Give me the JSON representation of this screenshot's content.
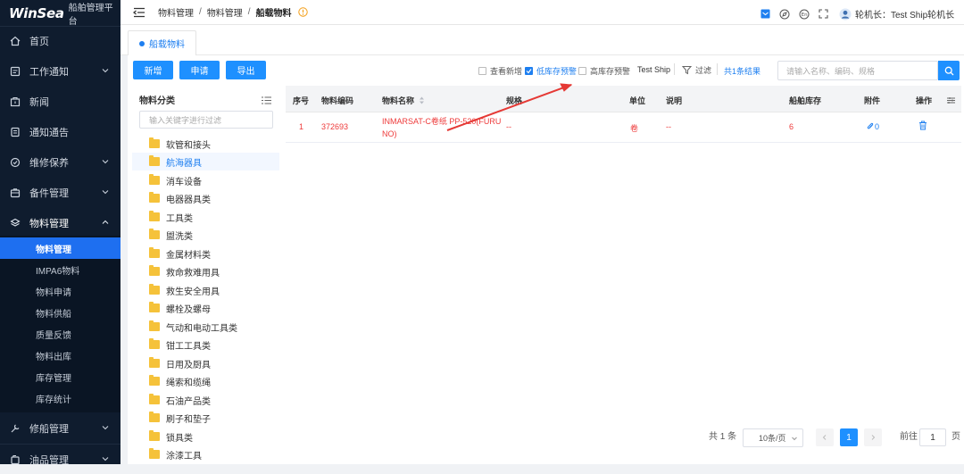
{
  "brand": {
    "logo": "WinSea",
    "subtitle": "船舶管理平台"
  },
  "sidebar": {
    "items": [
      {
        "label": "首页",
        "icon": "home-icon"
      },
      {
        "label": "工作通知",
        "icon": "notice-icon"
      },
      {
        "label": "新闻",
        "icon": "news-icon"
      },
      {
        "label": "通知通告",
        "icon": "announcement-icon"
      },
      {
        "label": "维修保养",
        "icon": "maintenance-icon"
      },
      {
        "label": "备件管理",
        "icon": "spare-parts-icon"
      },
      {
        "label": "物料管理",
        "icon": "materials-icon"
      },
      {
        "label": "修船管理",
        "icon": "repair-icon"
      },
      {
        "label": "油品管理",
        "icon": "oil-icon"
      }
    ],
    "subitems": [
      "物料管理",
      "IMPA6物料",
      "物料申请",
      "物料供船",
      "质量反馈",
      "物料出库",
      "库存管理",
      "库存统计"
    ]
  },
  "breadcrumb": {
    "l1": "物料管理",
    "l2": "物料管理",
    "l3": "船载物料"
  },
  "header": {
    "user": "轮机长：Test Ship轮机长"
  },
  "tab": {
    "label": "船载物料"
  },
  "toolbar": {
    "btn_new": "新增",
    "btn_apply": "申请",
    "btn_export": "导出",
    "chk_view_new": "查看新增",
    "chk_low_stock": "低库存预警",
    "chk_high_stock": "高库存预警",
    "ship": "Test Ship",
    "filter": "过滤",
    "result": "共1条结果",
    "search_placeholder": "请输入名称、编码、规格"
  },
  "tree": {
    "title": "物料分类",
    "placeholder": "输入关键字进行过滤",
    "nodes": [
      "软管和接头",
      "航海器具",
      "消车设备",
      "电器器具类",
      "工具类",
      "盥洗类",
      "金属材料类",
      "救命救难用具",
      "救生安全用具",
      "螺栓及螺母",
      "气动和电动工具类",
      "钳工工具类",
      "日用及厨具",
      "绳索和缆绳",
      "石油产品类",
      "刷子和垫子",
      "锁具类",
      "涂漆工具"
    ]
  },
  "table": {
    "headers": {
      "no": "序号",
      "code": "物料编码",
      "name": "物料名称",
      "spec": "规格",
      "unit": "单位",
      "desc": "说明",
      "stock": "船舶库存",
      "attach": "附件",
      "op": "操作"
    },
    "rows": [
      {
        "no": "1",
        "code": "372693",
        "name_line1": "INMARSAT-C卷纸 PP-520(FURU",
        "name_line2": "NO)",
        "spec": "--",
        "unit": "卷",
        "desc": "--",
        "stock": "6",
        "attach": "0"
      }
    ]
  },
  "pager": {
    "total": "共 1 条",
    "page_size": "10条/页",
    "current": "1",
    "goto_label": "前往",
    "goto_value": "1",
    "page_suffix": "页"
  },
  "colors": {
    "accent": "#1e90ff",
    "sidebar_bg": "#0f1c2e",
    "active_menu": "#1e6ff0",
    "row_text": "#ee3a3a",
    "arrow": "#e53935"
  }
}
